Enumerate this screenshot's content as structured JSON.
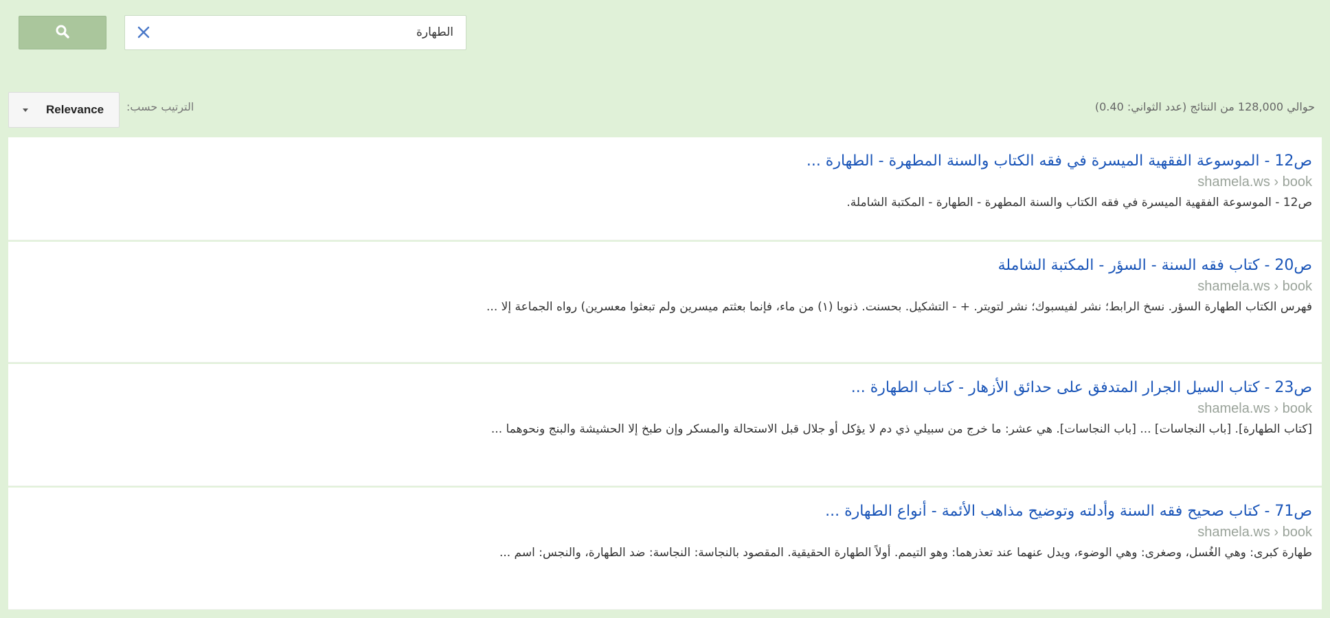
{
  "search": {
    "query": "الطهارة",
    "placeholder": ""
  },
  "sort": {
    "label": "الترتيب حسب:",
    "value": "Relevance"
  },
  "stats": {
    "text": "حوالي 128,000 من النتائج (عدد الثواني: 0.40)"
  },
  "results": [
    {
      "title": "ص12 - الموسوعة الفقهية الميسرة في فقه الكتاب والسنة المطهرة - الطهارة ...",
      "url": "shamela.ws › book",
      "snippet": "ص12 - الموسوعة الفقهية الميسرة في فقه الكتاب والسنة المطهرة - الطهارة - المكتبة الشاملة."
    },
    {
      "title": "ص20 - كتاب فقه السنة - السؤر - المكتبة الشاملة",
      "url": "shamela.ws › book",
      "snippet": "فهرس الكتاب الطهارة السؤر. نسخ الرابط؛ نشر لفيسبوك؛ نشر لتويتر. + - التشكيل. بحسنت. ذنوبا (١) من ماء، فإنما بعثتم ميسرين ولم تبعثوا معسرين) رواه الجماعة إلا ..."
    },
    {
      "title": "ص23 - كتاب السيل الجرار المتدفق على حدائق الأزهار - كتاب الطهارة ...",
      "url": "shamela.ws › book",
      "snippet": "[كتاب الطهارة]. [باب النجاسات] ... [باب النجاسات]. هي عشر: ما خرج من سبيلي ذي دم لا يؤكل أو جلال قبل الاستحالة والمسكر وإن طبخ إلا الحشيشة والبنج ونحوهما ..."
    },
    {
      "title": "ص71 - كتاب صحيح فقه السنة وأدلته وتوضيح مذاهب الأئمة - أنواع الطهارة ...",
      "url": "shamela.ws › book",
      "snippet": "طهارة كبرى: وهي الغُسل، وصغرى: وهي الوضوء، ويدل عنهما عند تعذرهما: وهو التيمم. أولاً الطهارة الحقيقية. المقصود بالنجاسة: النجاسة: ضد الطهارة، والنجس: اسم ..."
    }
  ],
  "colors": {
    "background": "#e0f1d8",
    "search_button": "#aac69c",
    "link": "#1a55b8",
    "url": "#9aa39a"
  }
}
